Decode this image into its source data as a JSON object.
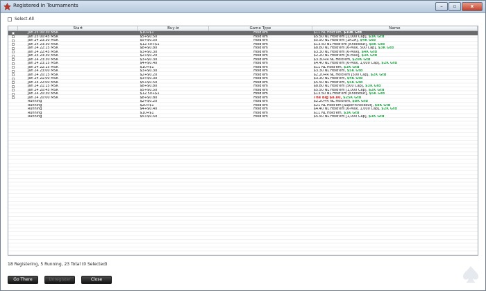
{
  "window": {
    "title": "Registered In Tournaments",
    "controls": [
      "–",
      "▫",
      "x"
    ]
  },
  "select_all": {
    "label": "Select All"
  },
  "columns": {
    "start": "Start",
    "buyin": "Buy-in",
    "game_type": "Game Type",
    "name": "Name"
  },
  "rows": [
    {
      "start": "Jan 25 00:30 MSK",
      "buyin": "$10+$1",
      "game": "Hold'em",
      "name": "$11 NL Hold'em, ",
      "gtd": "$10K Gtd",
      "selected": true
    },
    {
      "start": "Jan 25 00:45 MSK",
      "buyin": "$5+$0.50",
      "game": "Hold'em",
      "name": "$5.50 NL Hold'em [1,000 Cap], ",
      "gtd": "$3K Gtd"
    },
    {
      "start": "Jan 24 23:30 MSK",
      "buyin": "$5+$0.50",
      "game": "Hold'em",
      "name": "$5.50 NL Hold'em [1R1A], ",
      "gtd": "$4K Gtd"
    },
    {
      "start": "Jan 24 23:30 MSK",
      "buyin": "$12.50+$1",
      "game": "Hold'em",
      "name": "$13.50 NL Hold'em [Knockout], ",
      "gtd": "$8K Gtd"
    },
    {
      "start": "Jan 24 22:15 MSK",
      "buyin": "$8+$0.80",
      "game": "Hold'em",
      "name": "$8.80 NL Hold'em [6-Max, 500 Cap], ",
      "gtd": "$3K Gtd"
    },
    {
      "start": "Jan 24 22:45 MSK",
      "buyin": "$3+$0.30",
      "game": "Hold'em",
      "name": "$3.30 NL Hold'em [6-Max], ",
      "gtd": "$4K Gtd"
    },
    {
      "start": "Jan 24 23:30 MSK",
      "buyin": "$2+$0.20",
      "game": "Hold'em",
      "name": "$2.20 NL Hold'em [6-Max], ",
      "gtd": "$3K Gtd"
    },
    {
      "start": "Jan 24 23:30 MSK",
      "buyin": "$3+$0.30",
      "game": "Hold'em",
      "name": "$3.30+R NL Hold'em, ",
      "gtd": "$20K Gtd"
    },
    {
      "start": "Jan 24 23:15 MSK",
      "buyin": "$4+$0.40",
      "game": "Hold'em",
      "name": "$4.40 NL Hold'em [6-Max, 1,000 Cap], ",
      "gtd": "$2K Gtd"
    },
    {
      "start": "Jan 24 22:15 MSK",
      "buyin": "$10+$1",
      "game": "Hold'em",
      "name": "$11 NL Hold'em, ",
      "gtd": "$3K Gtd"
    },
    {
      "start": "Jan 24 23:00 MSK",
      "buyin": "$3+$0.30",
      "game": "Hold'em",
      "name": "$3.30 NL Hold'em, ",
      "gtd": "$5K Gtd"
    },
    {
      "start": "Jan 24 20:15 MSK",
      "buyin": "$2+$0.20",
      "game": "Hold'em",
      "name": "$2.20+R NL Hold'em [500 Cap], ",
      "gtd": "$2K Gtd"
    },
    {
      "start": "Jan 24 21:00 MSK",
      "buyin": "$3+$0.30",
      "game": "Hold'em",
      "name": "$3.30 NL Hold'em, ",
      "gtd": "$4K Gtd"
    },
    {
      "start": "Jan 24 22:00 MSK",
      "buyin": "$5+$0.50",
      "game": "Hold'em",
      "name": "$5.50 NL Hold'em, ",
      "gtd": "$5K Gtd"
    },
    {
      "start": "Jan 24 21:15 MSK",
      "buyin": "$8+$0.80",
      "game": "Hold'em",
      "name": "$8.80 NL Hold'em [500 Cap], ",
      "gtd": "$3K Gtd"
    },
    {
      "start": "Jan 24 20:45 MSK",
      "buyin": "$5+$0.50",
      "game": "Hold'em",
      "name": "$5.50 NL Hold'em [1,000 Cap], ",
      "gtd": "$2K Gtd"
    },
    {
      "start": "Jan 24 20:30 MSK",
      "buyin": "$12.50+$1",
      "game": "Hold'em",
      "name": "$13.50 NL Hold'em [Knockout], ",
      "gtd": "$5K Gtd"
    },
    {
      "start": "Jan 24 20:00 MSK",
      "buyin": "$8+$0.80",
      "game": "Hold'em",
      "name": "",
      "big": "The Big $8.80, ",
      "gtd": "$25K Gtd"
    },
    {
      "start": "Running",
      "buyin": "$2+$0.20",
      "game": "Hold'em",
      "name": "$2.20+R NL Hold'em, ",
      "gtd": "$8K Gtd",
      "running": true
    },
    {
      "start": "Running",
      "buyin": "$20+$1",
      "game": "Hold'em",
      "name": "$21 NL Hold'em [Super-Knockout], ",
      "gtd": "$8K Gtd",
      "running": true
    },
    {
      "start": "Running",
      "buyin": "$4+$0.40",
      "game": "Hold'em",
      "name": "$4.40 NL Hold'em [6-Max, 1,000 Cap], ",
      "gtd": "$2K Gtd",
      "running": true
    },
    {
      "start": "Running",
      "buyin": "$10+$1",
      "game": "Hold'em",
      "name": "$11 NL Hold'em, ",
      "gtd": "$3K Gtd",
      "running": true
    },
    {
      "start": "Running",
      "buyin": "$5+$0.50",
      "game": "Hold'em",
      "name": "$5.50 NL Hold'em [1,000 Cap], ",
      "gtd": "$3K Gtd",
      "running": true
    }
  ],
  "status": "18 Registering, 5 Running, 23 Total (0 Selected)",
  "buttons": {
    "go_there": "Go There",
    "unregister": "Unregister",
    "close": "Close"
  },
  "colors": {
    "guarantee": "#2aa84a",
    "featured": "#d8231a",
    "selected_row": "#6b6b6b"
  }
}
